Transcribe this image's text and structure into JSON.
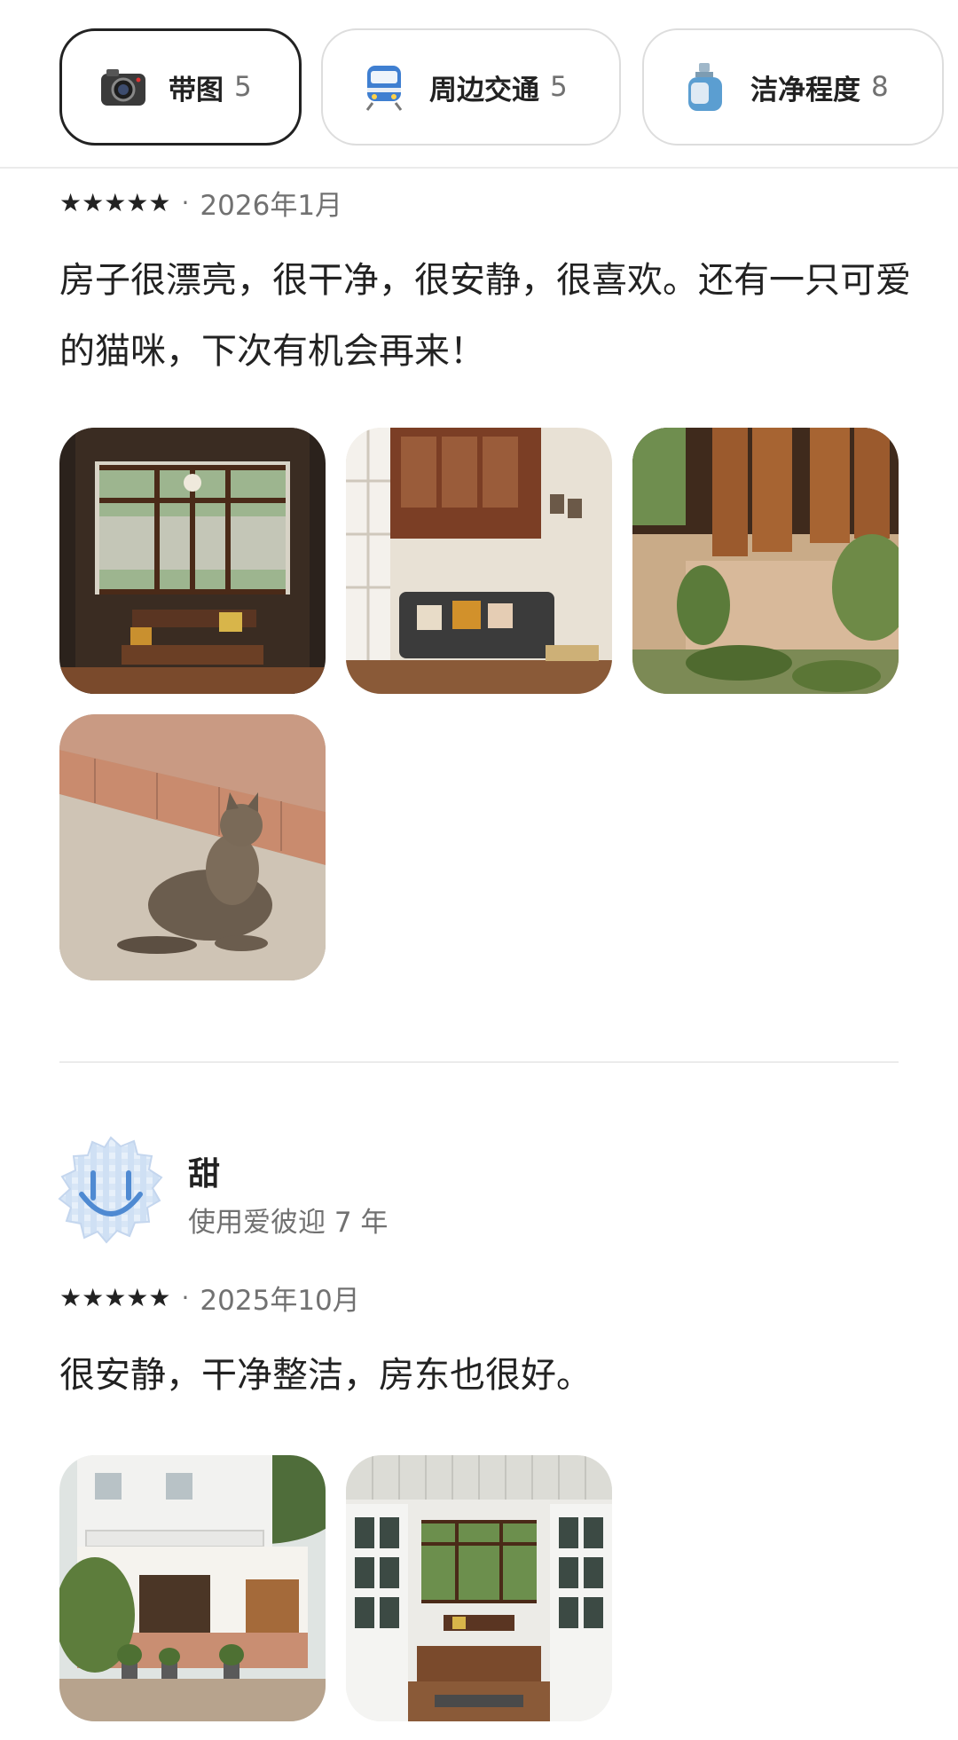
{
  "filters": [
    {
      "label": "带图",
      "count": "5",
      "icon": "camera-icon"
    },
    {
      "label": "周边交通",
      "count": "5",
      "icon": "train-icon"
    },
    {
      "label": "洁净程度",
      "count": "8",
      "icon": "soap-icon"
    }
  ],
  "review1": {
    "stars": "★★★★★",
    "separator": "·",
    "date": "2026年1月",
    "text": "房子很漂亮，很干净，很安静，很喜欢。还有一只可爱的猫咪，下次有机会再来！"
  },
  "review2": {
    "reviewer_name": "甜",
    "reviewer_meta": "使用爱彼迎 7 年",
    "stars": "★★★★★",
    "separator": "·",
    "date": "2025年10月",
    "text": "很安静，干净整洁，房东也很好。"
  },
  "colors": {
    "text_primary": "#222222",
    "text_secondary": "#717171",
    "border": "#dddddd",
    "divider": "#ebebeb"
  }
}
